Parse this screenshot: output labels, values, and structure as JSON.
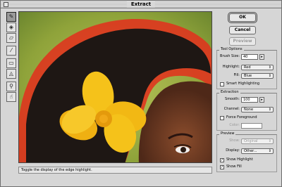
{
  "window": {
    "title": "Extract"
  },
  "toolbar": {
    "tools": [
      "edge-highlighter",
      "fill",
      "eraser",
      "eyedropper",
      "cleanup",
      "edge-touchup",
      "zoom",
      "hand"
    ]
  },
  "buttons": {
    "ok": "OK",
    "cancel": "Cancel",
    "preview": "Preview"
  },
  "tool_options": {
    "title": "Tool Options",
    "brush_size_label": "Brush Size:",
    "brush_size_value": "40",
    "highlight_label": "Highlight:",
    "highlight_value": "Red",
    "fill_label": "Fill:",
    "fill_value": "Blue",
    "smart_highlighting_label": "Smart Highlighting",
    "smart_highlighting_checked": false
  },
  "extraction": {
    "title": "Extraction",
    "smooth_label": "Smooth:",
    "smooth_value": "100",
    "channel_label": "Channel:",
    "channel_value": "None",
    "force_foreground_label": "Force Foreground",
    "force_foreground_checked": false,
    "color_label": "Color:"
  },
  "preview": {
    "title": "Preview",
    "show_label": "Show:",
    "show_value": "Original",
    "display_label": "Display:",
    "display_value": "Other...",
    "show_highlight_label": "Show Highlight",
    "show_highlight_checked": true,
    "show_fill_label": "Show Fill",
    "show_fill_checked": true
  },
  "status": {
    "text": "Toggle the display of the edge highlight."
  },
  "colors": {
    "highlight": "#e0321e",
    "flower": "#f5c21a",
    "background_green": "#8fa33a",
    "skin": "#6b3a24",
    "hair": "#1e1714"
  }
}
